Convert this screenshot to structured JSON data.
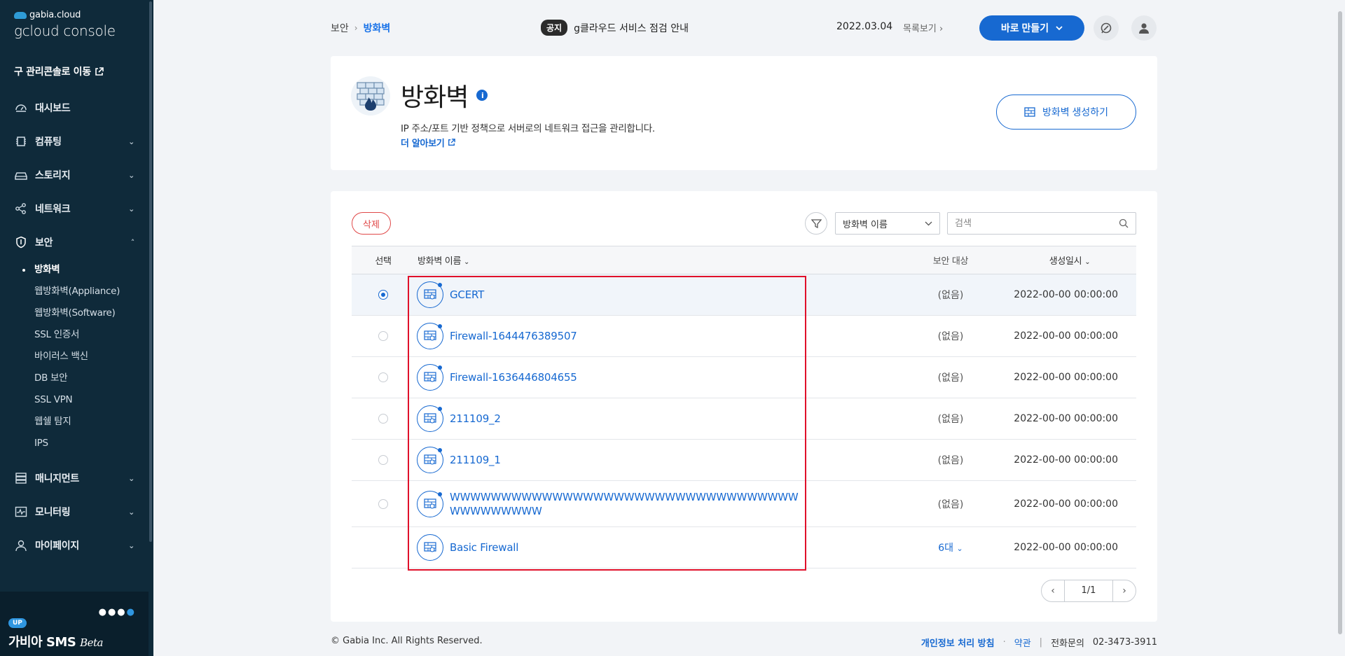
{
  "sidebar": {
    "brand": "gabia.cloud",
    "product": "gcloud console",
    "legacy_link": "구 관리콘솔로 이동",
    "nav": [
      {
        "label": "대시보드"
      },
      {
        "label": "컴퓨팅"
      },
      {
        "label": "스토리지"
      },
      {
        "label": "네트워크"
      },
      {
        "label": "보안"
      },
      {
        "label": "매니지먼트"
      },
      {
        "label": "모니터링"
      },
      {
        "label": "마이페이지"
      }
    ],
    "security_sub": [
      "방화벽",
      "웹방화벽(Appliance)",
      "웹방화벽(Software)",
      "SSL 인증서",
      "바이러스 백신",
      "DB 보안",
      "SSL VPN",
      "웹쉘 탐지",
      "IPS"
    ],
    "sms": {
      "badge": "UP",
      "title": "가비아 SMS",
      "beta": "Beta"
    }
  },
  "header": {
    "breadcrumb_parent": "보안",
    "breadcrumb_current": "방화벽",
    "notice_tag": "공지",
    "notice_text": "g클라우드 서비스 점검 안내",
    "notice_date": "2022.03.04",
    "notice_more": "목록보기",
    "create_button": "바로 만들기"
  },
  "hero": {
    "title": "방화벽",
    "description": "IP 주소/포트 기반 정책으로 서버로의 네트워크 접근을 관리합니다.",
    "learn_more": "더 알아보기",
    "create_button": "방화벽 생성하기"
  },
  "list": {
    "delete_button": "삭제",
    "filter_select": "방화벽 이름",
    "search_placeholder": "검색",
    "columns": {
      "select": "선택",
      "name": "방화벽 이름",
      "target": "보안 대상",
      "created": "생성일시"
    },
    "rows": [
      {
        "name": "GCERT",
        "target": "(없음)",
        "created": "2022-00-00 00:00:00"
      },
      {
        "name": "Firewall-1644476389507",
        "target": "(없음)",
        "created": "2022-00-00 00:00:00"
      },
      {
        "name": "Firewall-1636446804655",
        "target": "(없음)",
        "created": "2022-00-00 00:00:00"
      },
      {
        "name": "211109_2",
        "target": "(없음)",
        "created": "2022-00-00 00:00:00"
      },
      {
        "name": "211109_1",
        "target": "(없음)",
        "created": "2022-00-00 00:00:00"
      },
      {
        "name": "WWWWWWWWWWWWWWWWWWWWWWWWWWWWWWWWWWWWWWWWWWW",
        "target": "(없음)",
        "created": "2022-00-00 00:00:00"
      },
      {
        "name": "Basic Firewall",
        "target": "6대",
        "created": "2022-00-00 00:00:00"
      }
    ],
    "selected_row": "GCERT",
    "pagination": "1/1"
  },
  "footer": {
    "copyright": "© Gabia Inc. All Rights Reserved.",
    "privacy": "개인정보 처리 방침",
    "terms": "약관",
    "contact_label": "전화문의",
    "contact_number": "02-3473-3911"
  },
  "colors": {
    "sidebar_bg": "#0f2a3a",
    "accent": "#1769d1",
    "danger": "#e04848",
    "highlight": "#e0102a"
  }
}
